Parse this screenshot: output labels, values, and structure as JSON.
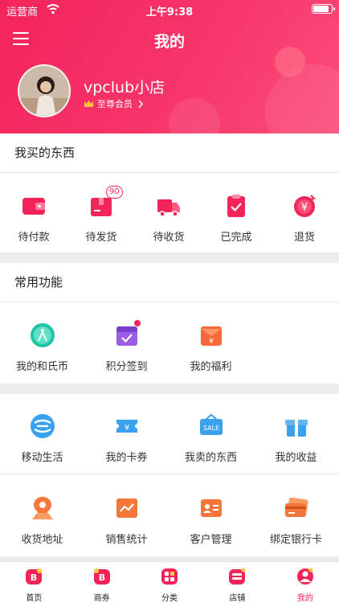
{
  "status_bar": {
    "carrier": "运营商",
    "time": "上午9:38",
    "battery": 0.9
  },
  "header": {
    "title": "我的",
    "username": "vpclub小店",
    "member_level": "至尊会员"
  },
  "orders": {
    "title": "我买的东西",
    "items": [
      {
        "label": "待付款",
        "icon": "wallet-icon"
      },
      {
        "label": "待发货",
        "icon": "package-icon",
        "badge": "90"
      },
      {
        "label": "待收货",
        "icon": "truck-icon"
      },
      {
        "label": "已完成",
        "icon": "clipboard-check-icon"
      },
      {
        "label": "退货",
        "icon": "yuan-refund-icon"
      }
    ]
  },
  "common": {
    "title": "常用功能",
    "items": [
      {
        "label": "我的和氏币",
        "icon": "coin-icon"
      },
      {
        "label": "积分签到",
        "icon": "calendar-check-icon"
      },
      {
        "label": "我的福利",
        "icon": "red-envelope-icon"
      }
    ]
  },
  "services": {
    "row1": [
      {
        "label": "移动生活",
        "icon": "china-mobile-icon"
      },
      {
        "label": "我的卡券",
        "icon": "coupon-icon"
      },
      {
        "label": "我卖的东西",
        "icon": "sale-tag-icon",
        "tag": "SALE"
      },
      {
        "label": "我的收益",
        "icon": "gift-box-icon"
      }
    ],
    "row2": [
      {
        "label": "收货地址",
        "icon": "location-pin-icon"
      },
      {
        "label": "销售统计",
        "icon": "line-chart-icon"
      },
      {
        "label": "客户管理",
        "icon": "contact-card-icon"
      },
      {
        "label": "绑定银行卡",
        "icon": "bank-card-icon"
      }
    ]
  },
  "tabbar": [
    {
      "label": "首页",
      "icon": "home-b-icon"
    },
    {
      "label": "商券",
      "icon": "coupon-b-icon"
    },
    {
      "label": "分类",
      "icon": "category-grid-icon"
    },
    {
      "label": "店铺",
      "icon": "store-icon"
    },
    {
      "label": "我的",
      "icon": "profile-icon",
      "active": true
    }
  ],
  "colors": {
    "brand": "#f3245a",
    "blue": "#3aa0f0",
    "orange": "#f5773a"
  }
}
